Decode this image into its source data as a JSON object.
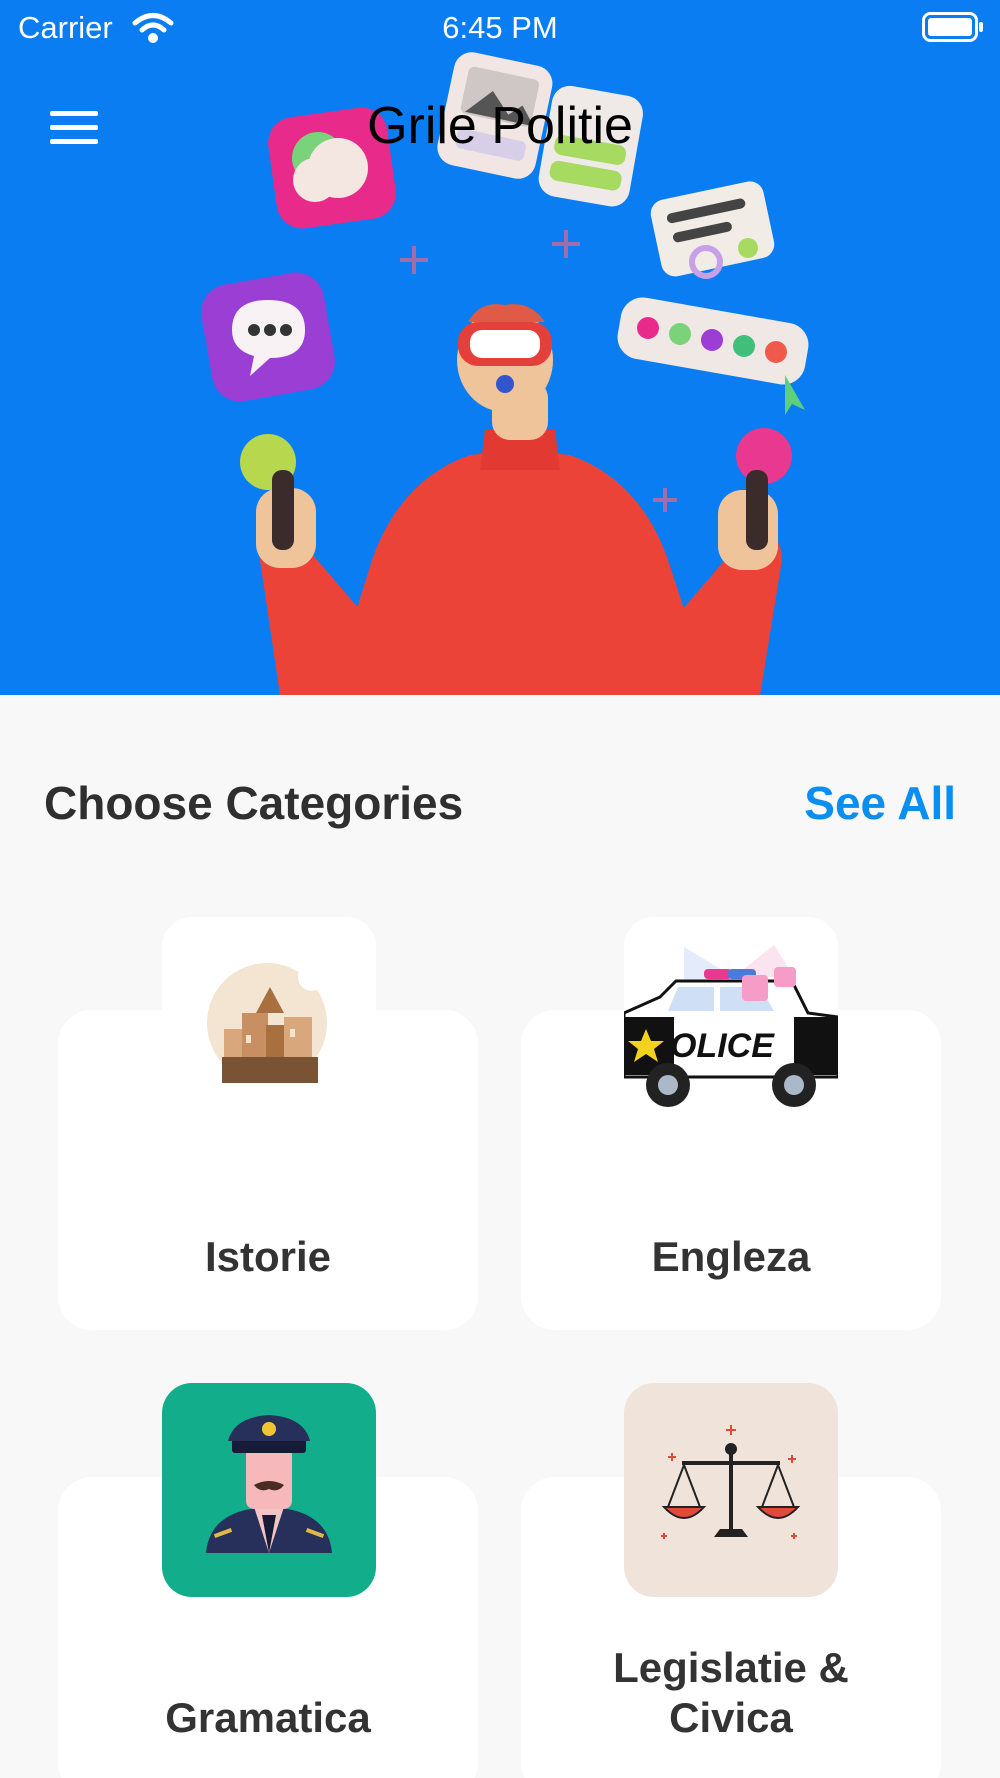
{
  "status_bar": {
    "carrier": "Carrier",
    "time": "6:45 PM",
    "wifi_icon": "wifi-icon",
    "battery_icon": "battery-icon"
  },
  "header": {
    "title": "Grile Politie",
    "menu_icon": "hamburger-menu-icon",
    "hero_image": "person-vr-headset-juggling-icons-illustration"
  },
  "categories_section": {
    "title": "Choose Categories",
    "see_all_label": "See All"
  },
  "categories": [
    {
      "label": "Istorie",
      "icon": "ancient-city-icon"
    },
    {
      "label": "Engleza",
      "icon": "police-car-icon"
    },
    {
      "label": "Gramatica",
      "icon": "police-officer-icon"
    },
    {
      "label": "Legislatie & Civica",
      "icon": "scales-of-justice-icon"
    }
  ],
  "colors": {
    "hero_background": "#0a7df2",
    "accent": "#0a8ef0",
    "page_background": "#f8f8f8",
    "card_background": "#ffffff",
    "officer_tile": "#12ae8c",
    "scales_tile": "#f0e4da"
  }
}
